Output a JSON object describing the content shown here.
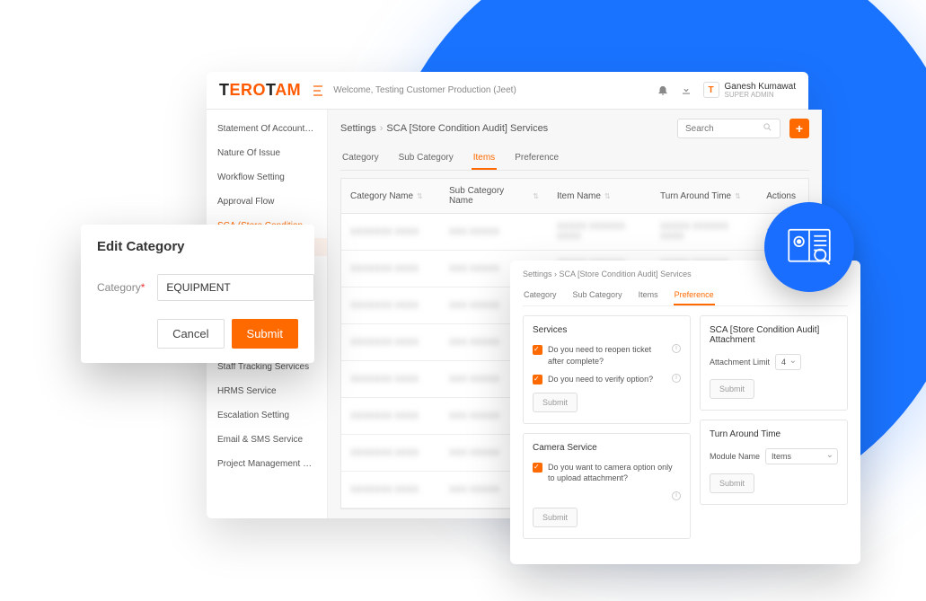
{
  "header": {
    "logo_part1": "T",
    "logo_part2": "ERO",
    "logo_part3": "T",
    "logo_part4": "AM",
    "welcome": "Welcome, Testing Customer Production (Jeet)",
    "user_name": "Ganesh Kumawat",
    "user_role": "SUPER ADMIN",
    "user_badge": "T"
  },
  "sidebar": {
    "items": [
      "Statement Of Account S…",
      "Nature Of Issue",
      "Workflow Setting",
      "Approval Flow",
      "SCA (Store Condition …",
      "Staff Tracking Services",
      "HRMS Service",
      "Escalation Setting",
      "Email & SMS Service",
      "Project Management Ser…"
    ]
  },
  "breadcrumb": {
    "root": "Settings",
    "leaf": "SCA [Store Condition Audit] Services"
  },
  "search": {
    "placeholder": "Search"
  },
  "tabs": [
    "Category",
    "Sub Category",
    "Items",
    "Preference"
  ],
  "active_tab": "Items",
  "table": {
    "headers": [
      "Category Name",
      "Sub Category Name",
      "Item Name",
      "Turn Around Time",
      "Actions"
    ],
    "rows": 8
  },
  "modal": {
    "title": "Edit Category",
    "field_label": "Category",
    "field_value": "EQUIPMENT",
    "cancel": "Cancel",
    "submit": "Submit"
  },
  "pref": {
    "crumb_root": "Settings",
    "crumb_leaf": "SCA [Store Condition Audit] Services",
    "tabs": [
      "Category",
      "Sub Category",
      "Items",
      "Preference"
    ],
    "active": "Preference",
    "services_title": "Services",
    "services_q1": "Do you need to reopen ticket after complete?",
    "services_q2": "Do you need to verify option?",
    "camera_title": "Camera Service",
    "camera_q": "Do you want to camera option only to upload attachment?",
    "attach_title": "SCA [Store Condition Audit] Attachment",
    "attach_label": "Attachment Limit",
    "attach_value": "4",
    "tat_title": "Turn Around Time",
    "tat_label": "Module Name",
    "tat_value": "Items",
    "submit": "Submit"
  }
}
